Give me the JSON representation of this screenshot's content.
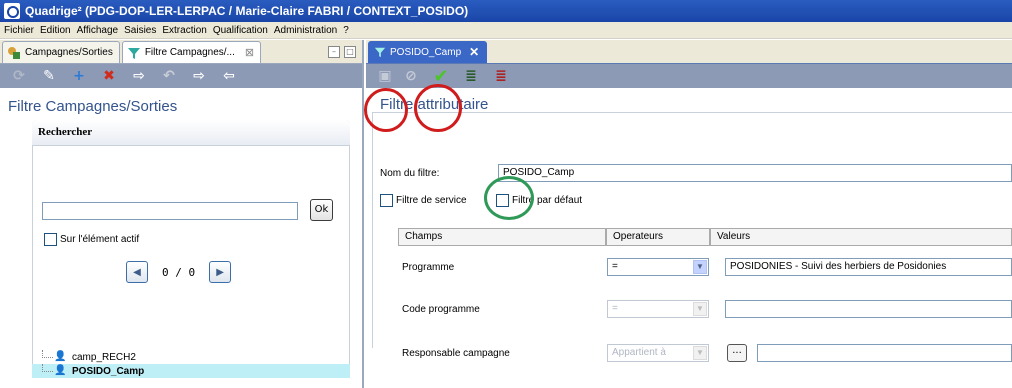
{
  "window": {
    "title": "Quadrige² (PDG-DOP-LER-LERPAC / Marie-Claire FABRI / CONTEXT_POSIDO)"
  },
  "menu": [
    "Fichier",
    "Edition",
    "Affichage",
    "Saisies",
    "Extraction",
    "Qualification",
    "Administration",
    "?"
  ],
  "left": {
    "tabs": [
      {
        "label": "Campagnes/Sorties",
        "icon": "campaign-icon"
      },
      {
        "label": "Filtre Campagnes/...",
        "icon": "filter-icon",
        "close": "⊠"
      }
    ],
    "toolbar": [
      "refresh-icon",
      "edit-icon",
      "add-icon",
      "delete-icon",
      "export-icon",
      "undo-icon",
      "export-alt-icon",
      "import-icon"
    ],
    "title": "Filtre Campagnes/Sorties",
    "search": {
      "header": "Rechercher",
      "value": "",
      "ok_label": "Ok",
      "active_label": "Sur l'élément actif",
      "position": "0 / 0"
    },
    "tree": [
      {
        "label": "camp_RECH2",
        "selected": false
      },
      {
        "label": "POSIDO_Camp",
        "selected": true
      }
    ]
  },
  "right": {
    "tab": {
      "label": "POSIDO_Camp",
      "close": "✕"
    },
    "toolbar": [
      "save-icon",
      "link-icon",
      "validate-icon",
      "sort-asc-icon",
      "sort-desc-icon"
    ],
    "title": "Filtre attributaire",
    "form": {
      "name_label": "Nom du filtre:",
      "name_value": "POSIDO_Camp",
      "service_label": "Filtre de service",
      "default_label": "Filtre par défaut"
    },
    "grid": {
      "headers": [
        "Champs",
        "Operateurs",
        "Valeurs"
      ],
      "rows": [
        {
          "field": "Programme",
          "operator": "=",
          "value": "POSIDONIES - Suivi des herbiers de Posidonies",
          "disabled": false
        },
        {
          "field": "Code programme",
          "operator": "=",
          "value": "",
          "disabled": true
        },
        {
          "field": "Responsable campagne",
          "operator": "Appartient à",
          "value": "",
          "disabled": true,
          "button": "..."
        }
      ]
    }
  },
  "colors": {
    "accent": "#34548d",
    "annotation_red": "#d01c1c",
    "annotation_green": "#2f9a58"
  }
}
